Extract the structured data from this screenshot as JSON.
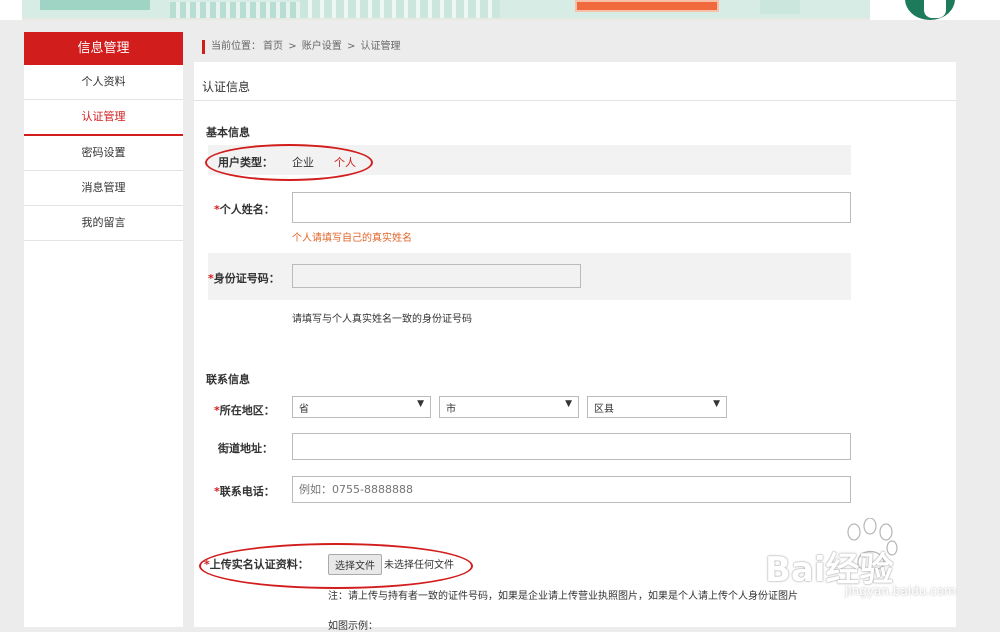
{
  "sidebar": {
    "title": "信息管理",
    "items": [
      {
        "label": "个人资料"
      },
      {
        "label": "认证管理"
      },
      {
        "label": "密码设置"
      },
      {
        "label": "消息管理"
      },
      {
        "label": "我的留言"
      }
    ]
  },
  "breadcrumb": {
    "prefix": "当前位置：",
    "home": "首页",
    "sep": ">",
    "account": "账户设置",
    "current": "认证管理"
  },
  "page": {
    "title": "认证信息"
  },
  "basic": {
    "title": "基本信息",
    "user_type_label": "用户类型：",
    "user_type_options": [
      "企业",
      "个人"
    ],
    "name_label": "个人姓名：",
    "name_hint": "个人请填写自己的真实姓名",
    "id_label": "身份证号码：",
    "id_hint": "请填写与个人真实姓名一致的身份证号码"
  },
  "contact": {
    "title": "联系信息",
    "region_label": "所在地区：",
    "province": "省",
    "city": "市",
    "district": "区县",
    "street_label": "街道地址：",
    "phone_label": "联系电话：",
    "phone_placeholder": "例如：0755-8888888"
  },
  "upload": {
    "label": "上传实名认证资料：",
    "button": "选择文件",
    "status": "未选择任何文件",
    "note": "注：请上传与持有者一致的证件号码，如果是企业请上传营业执照图片，如果是个人请上传个人身份证图片",
    "example": "如图示例："
  },
  "watermark": {
    "brand": "Bai经验",
    "url": "jingyan.baidu.com"
  },
  "colors": {
    "accent": "#d21d1d",
    "hint": "#e0662a"
  }
}
